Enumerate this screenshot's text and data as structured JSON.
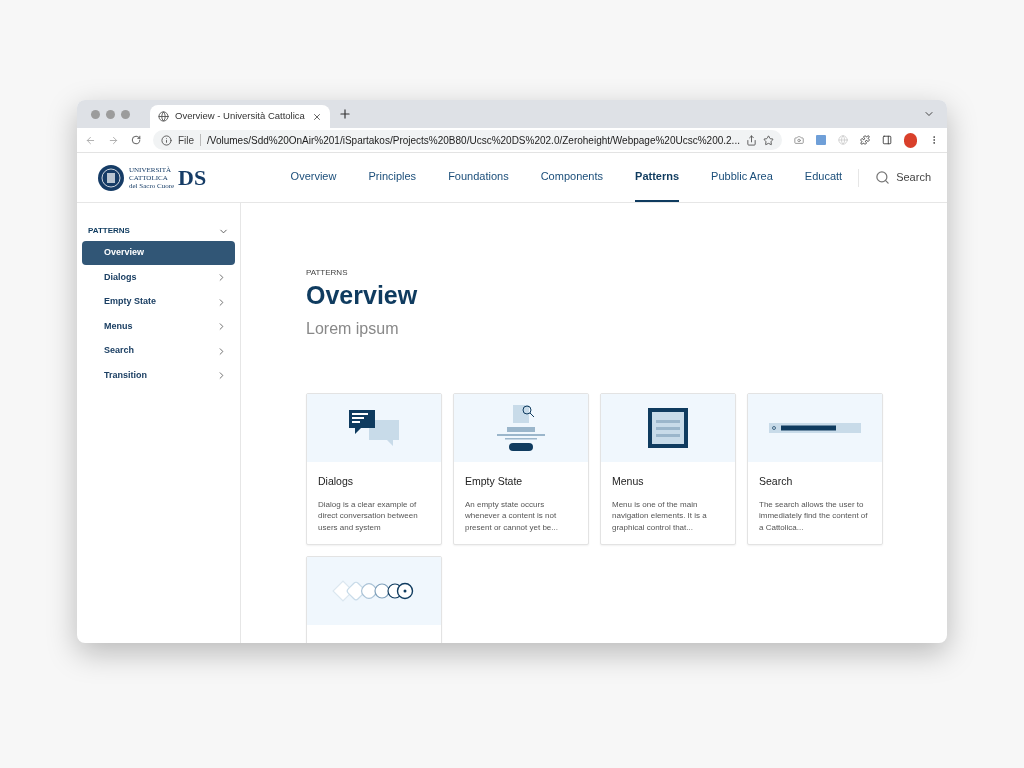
{
  "browser": {
    "tab_title": "Overview - Università Cattolica",
    "url_scheme": "File",
    "url": "/Volumes/Sdd%20OnAir%201/iSpartakos/Projects%20B80/Ucsc%20DS%202.0/Zeroheight/Webpage%20Ucsc%200.2..."
  },
  "header": {
    "logo": {
      "line_1": "UNIVERSITÀ",
      "line_2": "CATTOLICA",
      "line_3": "del Sacro Cuore",
      "mark": "DS"
    },
    "nav": [
      {
        "label": "Overview",
        "selected": false
      },
      {
        "label": "Principles",
        "selected": false
      },
      {
        "label": "Foundations",
        "selected": false
      },
      {
        "label": "Components",
        "selected": false
      },
      {
        "label": "Patterns",
        "selected": true
      },
      {
        "label": "Pubblic Area",
        "selected": false
      },
      {
        "label": "Educatt",
        "selected": false
      }
    ],
    "search": "Search"
  },
  "sidebar": {
    "section": "PATTERNS",
    "expanded": true,
    "items": [
      {
        "label": "Overview",
        "selected": true,
        "has_children": false
      },
      {
        "label": "Dialogs",
        "selected": false,
        "has_children": true
      },
      {
        "label": "Empty State",
        "selected": false,
        "has_children": true
      },
      {
        "label": "Menus",
        "selected": false,
        "has_children": true
      },
      {
        "label": "Search",
        "selected": false,
        "has_children": true
      },
      {
        "label": "Transition",
        "selected": false,
        "has_children": true
      }
    ]
  },
  "main": {
    "eyebrow": "PATTERNS",
    "title": "Overview",
    "subtitle": "Lorem ipsum",
    "cards": [
      {
        "kind": "dialogs",
        "title": "Dialogs",
        "description": "Dialog is a clear example of direct conversation between users and system"
      },
      {
        "kind": "empty",
        "title": "Empty State",
        "description": "An empty state occurs whenever a content is not present or cannot yet be..."
      },
      {
        "kind": "menus",
        "title": "Menus",
        "description": "Menu is one of the main navigation elements. It is a graphical control that..."
      },
      {
        "kind": "search",
        "title": "Search",
        "description": "The search allows the user to immediately find the content of a Cattolica..."
      },
      {
        "kind": "transition"
      }
    ]
  }
}
